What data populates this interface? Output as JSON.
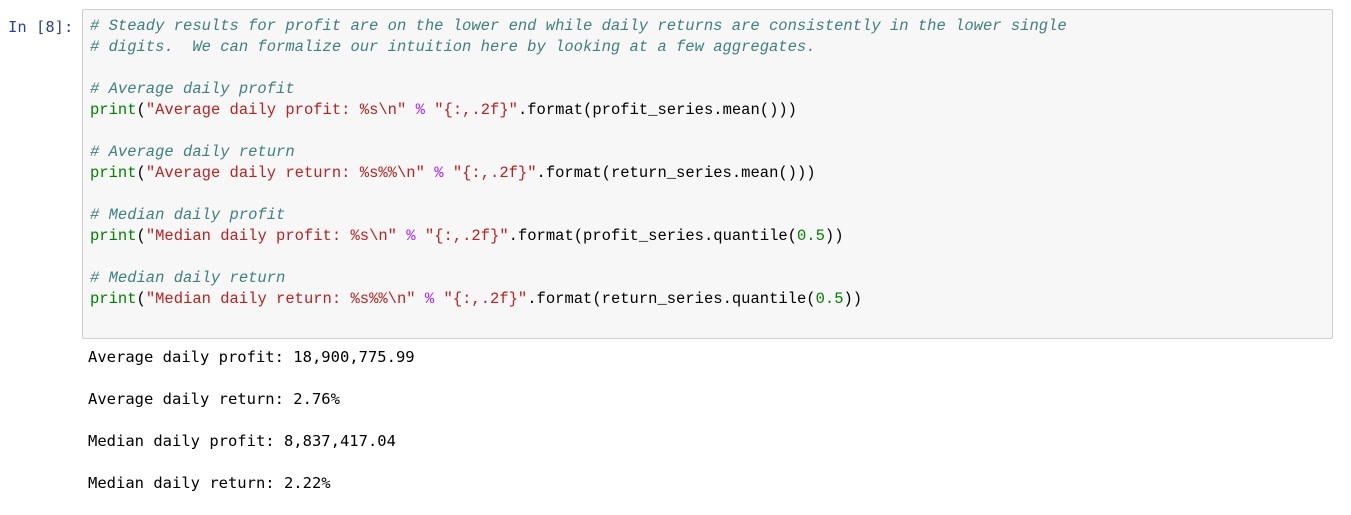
{
  "cell": {
    "prompt": "In [8]:",
    "code_lines": [
      {
        "tokens": [
          {
            "t": "comment",
            "v": "# Steady results for profit are on the lower end while daily returns are consistently in the lower single"
          }
        ]
      },
      {
        "tokens": [
          {
            "t": "comment",
            "v": "# digits.  We can formalize our intuition here by looking at a few aggregates."
          }
        ]
      },
      {
        "tokens": []
      },
      {
        "tokens": [
          {
            "t": "comment",
            "v": "# Average daily profit"
          }
        ]
      },
      {
        "tokens": [
          {
            "t": "builtin",
            "v": "print"
          },
          {
            "t": "plain",
            "v": "("
          },
          {
            "t": "string",
            "v": "\"Average daily profit: %s\\n\""
          },
          {
            "t": "plain",
            "v": " "
          },
          {
            "t": "op",
            "v": "%"
          },
          {
            "t": "plain",
            "v": " "
          },
          {
            "t": "string",
            "v": "\"{:,.2f}\""
          },
          {
            "t": "plain",
            "v": ".format(profit_series.mean()))"
          }
        ]
      },
      {
        "tokens": []
      },
      {
        "tokens": [
          {
            "t": "comment",
            "v": "# Average daily return"
          }
        ]
      },
      {
        "tokens": [
          {
            "t": "builtin",
            "v": "print"
          },
          {
            "t": "plain",
            "v": "("
          },
          {
            "t": "string",
            "v": "\"Average daily return: %s%%\\n\""
          },
          {
            "t": "plain",
            "v": " "
          },
          {
            "t": "op",
            "v": "%"
          },
          {
            "t": "plain",
            "v": " "
          },
          {
            "t": "string",
            "v": "\"{:,.2f}\""
          },
          {
            "t": "plain",
            "v": ".format(return_series.mean()))"
          }
        ]
      },
      {
        "tokens": []
      },
      {
        "tokens": [
          {
            "t": "comment",
            "v": "# Median daily profit"
          }
        ]
      },
      {
        "tokens": [
          {
            "t": "builtin",
            "v": "print"
          },
          {
            "t": "plain",
            "v": "("
          },
          {
            "t": "string",
            "v": "\"Median daily profit: %s\\n\""
          },
          {
            "t": "plain",
            "v": " "
          },
          {
            "t": "op",
            "v": "%"
          },
          {
            "t": "plain",
            "v": " "
          },
          {
            "t": "string",
            "v": "\"{:,.2f}\""
          },
          {
            "t": "plain",
            "v": ".format(profit_series.quantile("
          },
          {
            "t": "number",
            "v": "0.5"
          },
          {
            "t": "plain",
            "v": "))"
          }
        ]
      },
      {
        "tokens": []
      },
      {
        "tokens": [
          {
            "t": "comment",
            "v": "# Median daily return"
          }
        ]
      },
      {
        "tokens": [
          {
            "t": "builtin",
            "v": "print"
          },
          {
            "t": "plain",
            "v": "("
          },
          {
            "t": "string",
            "v": "\"Median daily return: %s%%\\n\""
          },
          {
            "t": "plain",
            "v": " "
          },
          {
            "t": "op",
            "v": "%"
          },
          {
            "t": "plain",
            "v": " "
          },
          {
            "t": "string",
            "v": "\"{:,.2f}\""
          },
          {
            "t": "plain",
            "v": ".format(return_series.quantile("
          },
          {
            "t": "number",
            "v": "0.5"
          },
          {
            "t": "plain",
            "v": "))"
          }
        ]
      }
    ]
  },
  "output": {
    "lines": [
      "Average daily profit: 18,900,775.99",
      "Average daily return: 2.76%",
      "Median daily profit: 8,837,417.04",
      "Median daily return: 2.22%"
    ]
  },
  "colors": {
    "prompt": "#303f9f",
    "comment": "#408080",
    "builtin": "#008000",
    "string": "#ba2121",
    "operator": "#aa22ff",
    "number": "#008000",
    "cell_background": "#f7f7f7",
    "cell_border": "#cfcfcf"
  }
}
